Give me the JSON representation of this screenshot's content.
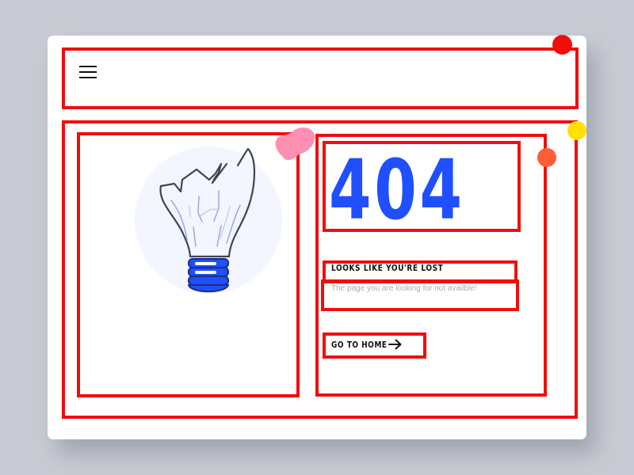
{
  "header": {
    "menu_icon": "hamburger-icon"
  },
  "illustration": {
    "icon": "broken-light-bulb-icon"
  },
  "error": {
    "code": "404",
    "title": "LOOKS LIKE YOU'RE LOST",
    "message": "The page you are looking for not availble!"
  },
  "actions": {
    "home_label": "GO TO HOME",
    "home_icon": "arrow-right-icon"
  },
  "colors": {
    "accent": "#1f4fff",
    "outline": "#f20d0d",
    "background": "#c8cbd3",
    "card": "#ffffff",
    "message": "#a8acb6",
    "dot_red": "#f20d0d",
    "dot_yellow": "#ffe100",
    "dot_orange": "#ff5d38",
    "blob_pink": "#ff8fb1"
  }
}
